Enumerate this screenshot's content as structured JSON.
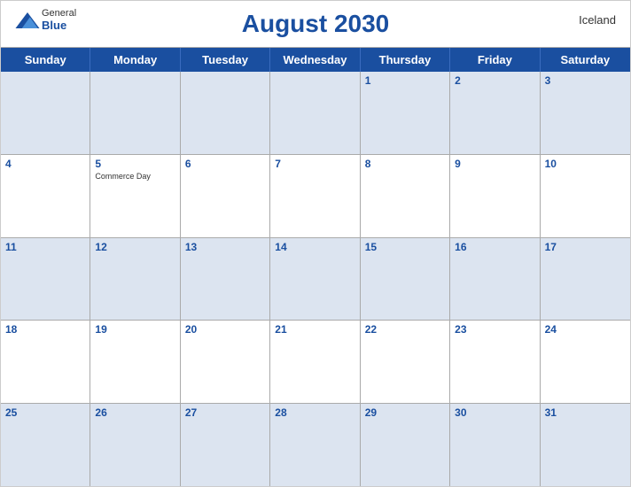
{
  "header": {
    "title": "August 2030",
    "country": "Iceland",
    "logo": {
      "general": "General",
      "blue": "Blue"
    }
  },
  "dayHeaders": [
    "Sunday",
    "Monday",
    "Tuesday",
    "Wednesday",
    "Thursday",
    "Friday",
    "Saturday"
  ],
  "weeks": [
    [
      {
        "day": "",
        "empty": true
      },
      {
        "day": "",
        "empty": true
      },
      {
        "day": "",
        "empty": true
      },
      {
        "day": "",
        "empty": true
      },
      {
        "day": "1",
        "event": ""
      },
      {
        "day": "2",
        "event": ""
      },
      {
        "day": "3",
        "event": ""
      }
    ],
    [
      {
        "day": "4",
        "event": ""
      },
      {
        "day": "5",
        "event": "Commerce Day"
      },
      {
        "day": "6",
        "event": ""
      },
      {
        "day": "7",
        "event": ""
      },
      {
        "day": "8",
        "event": ""
      },
      {
        "day": "9",
        "event": ""
      },
      {
        "day": "10",
        "event": ""
      }
    ],
    [
      {
        "day": "11",
        "event": ""
      },
      {
        "day": "12",
        "event": ""
      },
      {
        "day": "13",
        "event": ""
      },
      {
        "day": "14",
        "event": ""
      },
      {
        "day": "15",
        "event": ""
      },
      {
        "day": "16",
        "event": ""
      },
      {
        "day": "17",
        "event": ""
      }
    ],
    [
      {
        "day": "18",
        "event": ""
      },
      {
        "day": "19",
        "event": ""
      },
      {
        "day": "20",
        "event": ""
      },
      {
        "day": "21",
        "event": ""
      },
      {
        "day": "22",
        "event": ""
      },
      {
        "day": "23",
        "event": ""
      },
      {
        "day": "24",
        "event": ""
      }
    ],
    [
      {
        "day": "25",
        "event": ""
      },
      {
        "day": "26",
        "event": ""
      },
      {
        "day": "27",
        "event": ""
      },
      {
        "day": "28",
        "event": ""
      },
      {
        "day": "29",
        "event": ""
      },
      {
        "day": "30",
        "event": ""
      },
      {
        "day": "31",
        "event": ""
      }
    ]
  ],
  "colors": {
    "blue": "#1a4fa0",
    "lightBlue": "#e8edf7",
    "white": "#ffffff"
  }
}
